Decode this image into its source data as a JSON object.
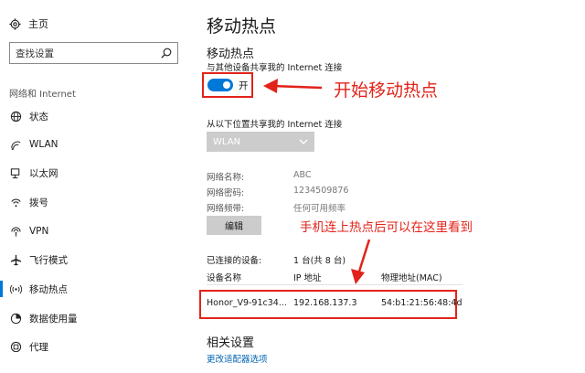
{
  "sidebar": {
    "home_label": "主页",
    "search_placeholder": "查找设置",
    "section_label": "网络和 Internet",
    "items": [
      {
        "label": "状态",
        "icon": "globe-icon"
      },
      {
        "label": "WLAN",
        "icon": "wifi-icon"
      },
      {
        "label": "以太网",
        "icon": "ethernet-icon"
      },
      {
        "label": "拨号",
        "icon": "dialup-icon"
      },
      {
        "label": "VPN",
        "icon": "vpn-icon"
      },
      {
        "label": "飞行模式",
        "icon": "airplane-icon"
      },
      {
        "label": "移动热点",
        "icon": "hotspot-icon",
        "active": true
      },
      {
        "label": "数据使用量",
        "icon": "data-usage-icon"
      },
      {
        "label": "代理",
        "icon": "proxy-icon"
      }
    ]
  },
  "main": {
    "page_title": "移动热点",
    "section_title": "移动热点",
    "share_description": "与其他设备共享我的 Internet 连接",
    "toggle_label": "开",
    "toggle_on": true,
    "share_from_label": "从以下位置共享我的 Internet 连接",
    "share_from_value": "WLAN",
    "network_name_label": "网络名称:",
    "network_name_value": "ABC",
    "network_password_label": "网络密码:",
    "network_password_value": "1234509876",
    "network_band_label": "网络频带:",
    "network_band_value": "任何可用频率",
    "edit_button": "编辑",
    "connected_label": "已连接的设备:",
    "connected_value": "1 台(共 8 台)",
    "table": {
      "headers": [
        "设备名称",
        "IP 地址",
        "物理地址(MAC)"
      ],
      "rows": [
        [
          "Honor_V9-91c34...",
          "192.168.137.3",
          "54:b1:21:56:48:4d"
        ]
      ]
    },
    "related_title": "相关设置",
    "adapter_link": "更改适配器选项"
  },
  "annotations": {
    "start_hotspot": "开始移动热点",
    "see_devices": "手机连上热点后可以在这里看到"
  },
  "colors": {
    "accent": "#0078d7",
    "annotation_red": "#e2231a",
    "link": "#0063b1"
  }
}
